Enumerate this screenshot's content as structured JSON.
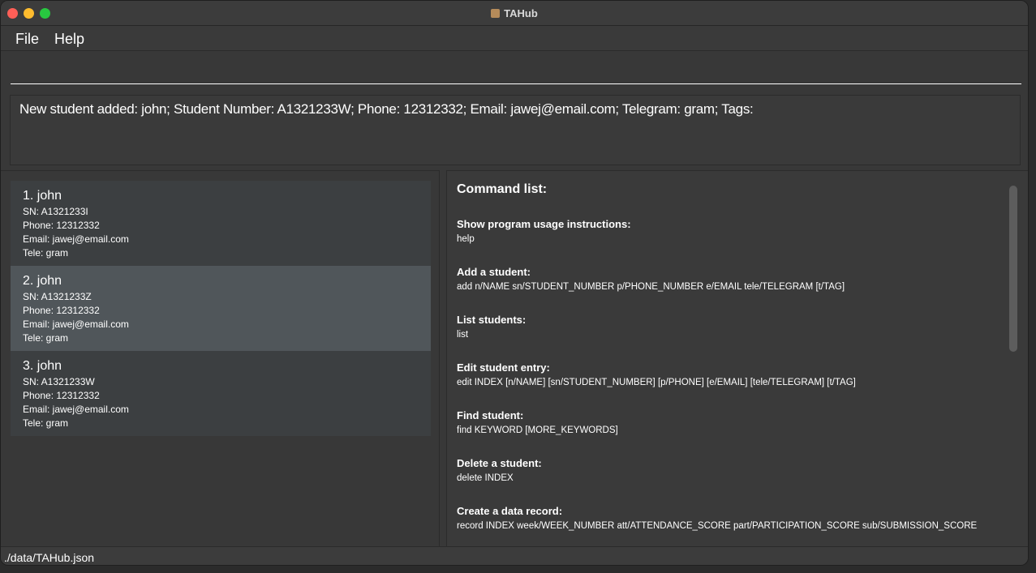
{
  "window": {
    "title": "TAHub"
  },
  "menu": {
    "file": "File",
    "help": "Help"
  },
  "command_box": {
    "value": "",
    "placeholder": ""
  },
  "result": {
    "text": "New student added: john; Student Number: A1321233W; Phone: 12312332; Email: jawej@email.com; Telegram: gram; Tags:"
  },
  "students": [
    {
      "name": "1. john",
      "sn": "SN: A1321233I",
      "phone": "Phone: 12312332",
      "email": "Email: jawej@email.com",
      "tele": "Tele: gram"
    },
    {
      "name": "2. john",
      "sn": "SN: A1321233Z",
      "phone": "Phone: 12312332",
      "email": "Email: jawej@email.com",
      "tele": "Tele: gram"
    },
    {
      "name": "3. john",
      "sn": "SN: A1321233W",
      "phone": "Phone: 12312332",
      "email": "Email: jawej@email.com",
      "tele": "Tele: gram"
    }
  ],
  "help": {
    "heading": "Command list:",
    "commands": [
      {
        "title": "Show program usage instructions:",
        "usage": "help"
      },
      {
        "title": "Add a student:",
        "usage": "add n/NAME sn/STUDENT_NUMBER p/PHONE_NUMBER e/EMAIL tele/TELEGRAM [t/TAG]"
      },
      {
        "title": "List students:",
        "usage": "list"
      },
      {
        "title": "Edit student entry:",
        "usage": "edit INDEX [n/NAME] [sn/STUDENT_NUMBER] [p/PHONE] [e/EMAIL] [tele/TELEGRAM] [t/TAG]"
      },
      {
        "title": "Find student:",
        "usage": "find KEYWORD [MORE_KEYWORDS]"
      },
      {
        "title": "Delete a student:",
        "usage": "delete INDEX"
      },
      {
        "title": "Create a data record:",
        "usage": "record INDEX week/WEEK_NUMBER att/ATTENDANCE_SCORE part/PARTICIPATION_SCORE sub/SUBMISSION_SCORE"
      }
    ]
  },
  "status": {
    "path": "./data/TAHub.json"
  }
}
